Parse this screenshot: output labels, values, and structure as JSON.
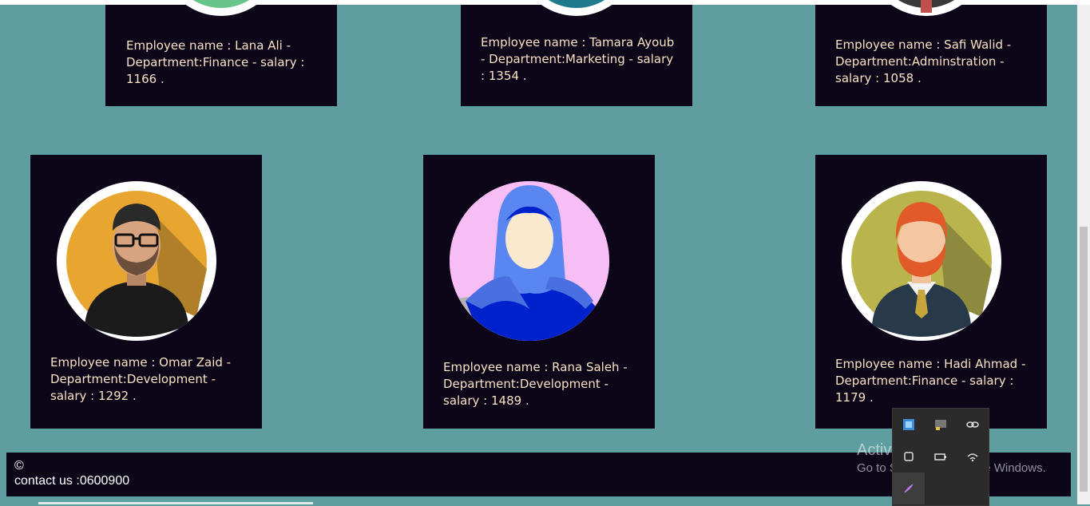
{
  "employees_top": [
    {
      "text": "Employee name : Lana Ali - Department:Finance - salary : 1166 ."
    },
    {
      "text": "Employee name : Tamara Ayoub - Department:Marketing - salary : 1354 ."
    },
    {
      "text": "Employee name : Safi Walid - Department:Adminstration - salary : 1058 ."
    }
  ],
  "employees_bottom": [
    {
      "text": "Employee name : Omar Zaid - Department:Development - salary : 1292 .",
      "avatar": "man-glasses-avatar"
    },
    {
      "text": "Employee name : Rana Saleh - Department:Development - salary : 1489 .",
      "avatar": "woman-hijab-avatar"
    },
    {
      "text": "Employee name : Hadi Ahmad - Department:Finance - salary : 1179 .",
      "avatar": "man-beard-avatar"
    }
  ],
  "footer": {
    "copyright": "©",
    "contact": "contact us :0600900"
  },
  "watermark": {
    "title": "Activate Windows",
    "subtitle": "Go to Settings to activate Windows."
  },
  "colors": {
    "page_bg": "#5f9ea0",
    "card_bg": "#0d0618",
    "card_text": "#f6e2c4"
  }
}
